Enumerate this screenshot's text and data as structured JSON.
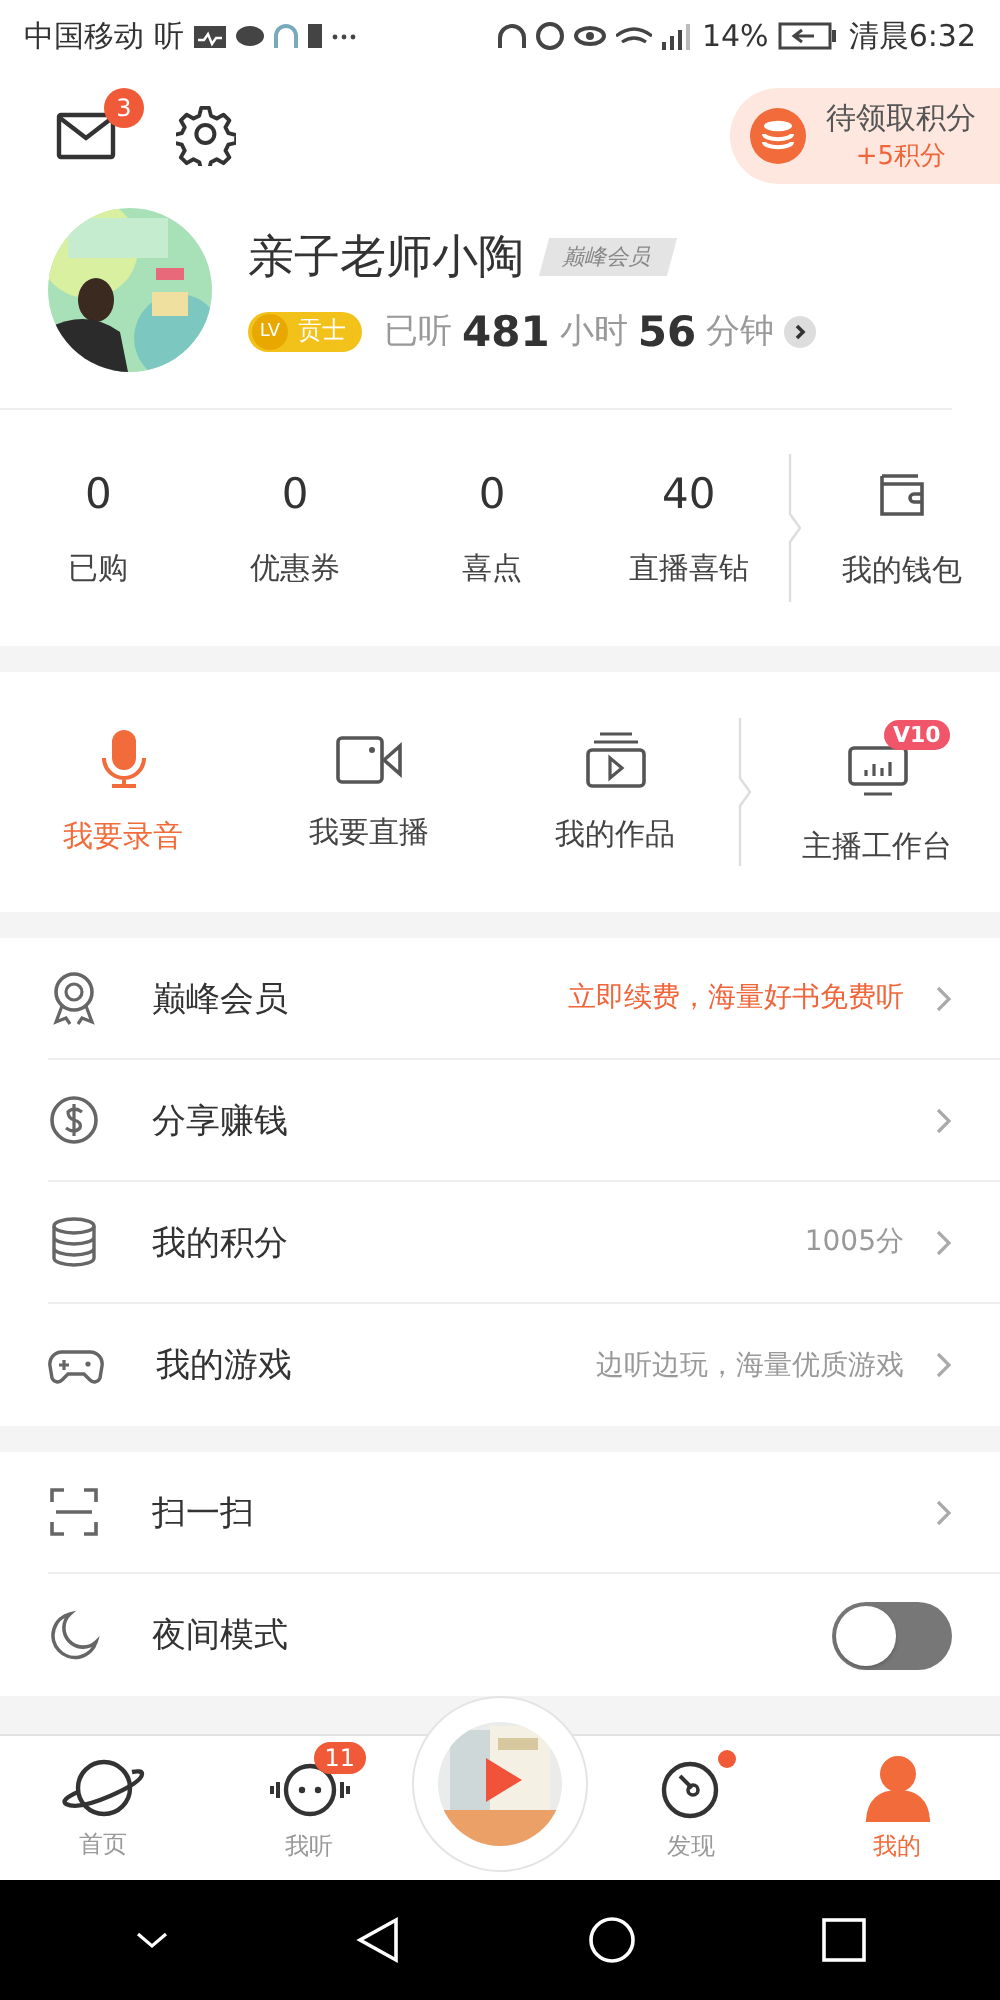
{
  "status_bar": {
    "carrier": "中国移动",
    "carrier_extra": "听",
    "battery": "14%",
    "time": "清晨6:32"
  },
  "header": {
    "messages_badge": "3",
    "points": {
      "title": "待领取积分",
      "reward": "+5积分"
    }
  },
  "profile": {
    "name": "亲子老师小陶",
    "member_badge": "巅峰会员",
    "level_icon": "LV",
    "level": "贡士",
    "listened_label": "已听",
    "hours": "481",
    "hours_unit": "小时",
    "minutes": "56",
    "minutes_unit": "分钟"
  },
  "stats": [
    {
      "value": "0",
      "label": "已购"
    },
    {
      "value": "0",
      "label": "优惠券"
    },
    {
      "value": "0",
      "label": "喜点"
    },
    {
      "value": "40",
      "label": "直播喜钻"
    }
  ],
  "wallet": {
    "label": "我的钱包"
  },
  "tools": [
    {
      "label": "我要录音",
      "active": true
    },
    {
      "label": "我要直播",
      "active": false
    },
    {
      "label": "我的作品",
      "active": false
    }
  ],
  "studio": {
    "label": "主播工作台",
    "badge": "V10"
  },
  "menu": [
    {
      "kind": "link",
      "label": "巅峰会员",
      "detail": "立即续费，海量好书免费听",
      "highlight": true
    },
    {
      "kind": "link",
      "label": "分享赚钱"
    },
    {
      "kind": "link",
      "label": "我的积分",
      "detail": "1005分",
      "highlight": false
    },
    {
      "kind": "link",
      "label": "我的游戏",
      "detail": "边听边玩，海量优质游戏",
      "highlight": false
    }
  ],
  "menu2": [
    {
      "kind": "link",
      "label": "扫一扫"
    },
    {
      "kind": "toggle",
      "label": "夜间模式",
      "on": false
    }
  ],
  "tabs": [
    {
      "label": "首页",
      "selected": false
    },
    {
      "label": "我听",
      "selected": false,
      "badge": "11"
    },
    {
      "label": "发现",
      "selected": false,
      "dot": true
    },
    {
      "label": "我的",
      "selected": true
    }
  ]
}
